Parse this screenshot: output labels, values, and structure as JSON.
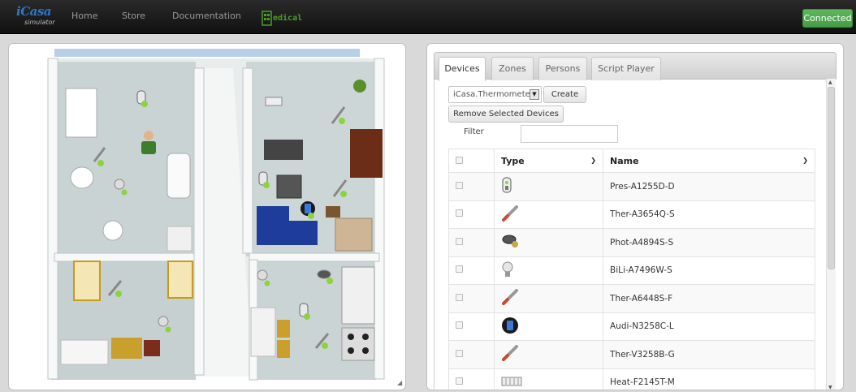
{
  "navbar": {
    "logo_main": "iCasa",
    "logo_sub": "simulator",
    "links": [
      "Home",
      "Store",
      "Documentation"
    ],
    "medical_logo": "edical",
    "status_button": "Connected"
  },
  "tabs": [
    "Devices",
    "Zones",
    "Persons",
    "Script Player"
  ],
  "active_tab": "Devices",
  "devices_tab": {
    "device_type_select": "iCasa.Thermometer",
    "create_button": "Create",
    "remove_button": "Remove Selected Devices",
    "filter_label": "Filter",
    "filter_value": "",
    "table": {
      "columns": [
        "Type",
        "Name"
      ],
      "rows": [
        {
          "type_icon": "presence-sensor-icon",
          "name": "Pres-A1255D-D"
        },
        {
          "type_icon": "thermometer-icon",
          "name": "Ther-A3654Q-S"
        },
        {
          "type_icon": "photometer-icon",
          "name": "Phot-A4894S-S"
        },
        {
          "type_icon": "binary-light-icon",
          "name": "BiLi-A7496W-S"
        },
        {
          "type_icon": "thermometer-icon",
          "name": "Ther-A6448S-F"
        },
        {
          "type_icon": "audio-speaker-icon",
          "name": "Audi-N3258C-L"
        },
        {
          "type_icon": "thermometer-icon",
          "name": "Ther-V3258B-G"
        },
        {
          "type_icon": "heater-icon",
          "name": "Heat-F2145T-M"
        }
      ]
    }
  },
  "colors": {
    "navbar": "#1c1c1c",
    "connected": "#5cb85c",
    "link": "#9a9a9a"
  }
}
